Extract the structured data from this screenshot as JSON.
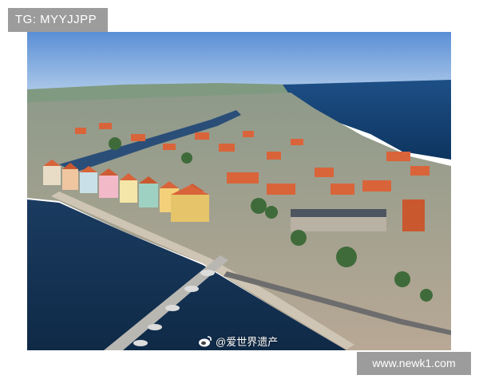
{
  "badges": {
    "top_left": "TG: MYYJJPP",
    "bottom_right": "www.newk1.com"
  },
  "photo": {
    "subject": "aerial-harbor-city",
    "watermark": "@爱世界遗产",
    "watermark_icon": "weibo-icon"
  },
  "colors": {
    "badge_bg": "#9c9c9c",
    "sky": "#6fa0d8",
    "sea_deep": "#123a63",
    "harbor_water": "#16365c",
    "roof_orange": "#d9643a",
    "bridge": "#b9b7b2"
  }
}
